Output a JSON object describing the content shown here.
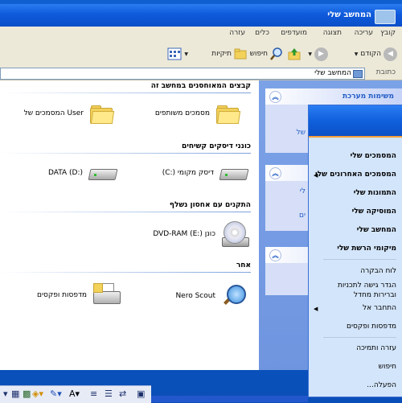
{
  "window": {
    "title": "המחשב שלי",
    "menu": [
      "קובץ",
      "עריכה",
      "תצוגה",
      "מועדפים",
      "כלים",
      "עזרה"
    ],
    "toolbar": {
      "back": "הקודם",
      "search": "חיפוש",
      "folders": "תיקיות"
    },
    "address_label": "כתובת",
    "address_value": "המחשב שלי"
  },
  "taskpane": {
    "system_tasks": "משימות מערכת",
    "other_places_fragment": "של",
    "fragment_2": "לי",
    "fragment_3": "ים"
  },
  "content": {
    "groups": [
      {
        "title": "קבצים המאוחסנים במחשב זה",
        "items": [
          "מסמכים משותפים",
          "User המסמכים של"
        ]
      },
      {
        "title": "כונני דיסקים קשיחים",
        "items": [
          "דיסק מקומי (:C)",
          "DATA (D:)"
        ]
      },
      {
        "title": "התקנים עם אחסון נשלף",
        "items": [
          "כונן DVD-RAM (E:)"
        ]
      },
      {
        "title": "אחר",
        "items": [
          "Nero Scout",
          "מדפסות ופקסים"
        ]
      }
    ]
  },
  "start_menu": {
    "items": [
      "המסמכים שלי",
      "המסמכים האחרונים שלי",
      "התמונות שלי",
      "המוסיקה שלי",
      "המחשב שלי",
      "מיקומי הרשת שלי",
      "לוח הבקרה",
      "הגדר גישה לתכניות",
      "וברירות מחדל",
      "התחבר אל",
      "מדפסות ופקסים",
      "עזרה ותמיכה",
      "חיפוש",
      "הפעלה..."
    ]
  },
  "office_toolbar": {
    "icons": [
      "dropdown-icon",
      "grid-icon",
      "table-icon",
      "fill-color-icon",
      "line-color-icon",
      "font-color-icon",
      "align-icon",
      "list-icon",
      "arrows-icon"
    ]
  }
}
